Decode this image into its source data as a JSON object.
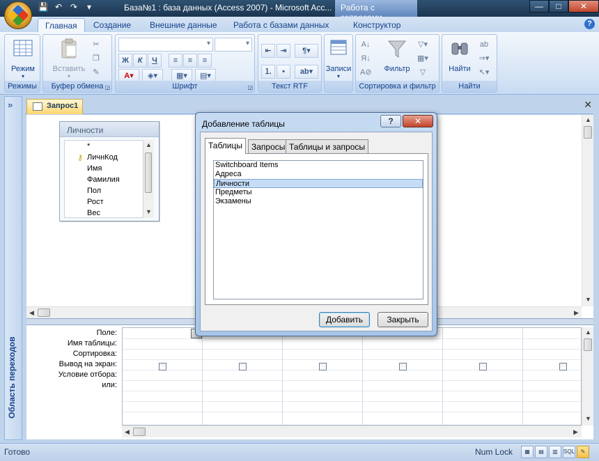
{
  "window": {
    "title": "База№1 : база данных (Access 2007) - Microsoft Acc...",
    "context_tab": "Работа с запросами",
    "controls": {
      "minimize": "—",
      "maximize": "□",
      "close": "✕"
    }
  },
  "quick_access": {
    "save": "💾",
    "undo": "↶",
    "redo": "↷",
    "customize": "▾"
  },
  "ribbon": {
    "tabs": [
      "Главная",
      "Создание",
      "Внешние данные",
      "Работа с базами данных",
      "Конструктор"
    ],
    "active_tab": "Главная",
    "help": "?",
    "groups": {
      "views": {
        "label": "Режимы",
        "button": "Режим"
      },
      "clipboard": {
        "label": "Буфер обмена",
        "button": "Вставить"
      },
      "font": {
        "label": "Шрифт",
        "bold": "Ж",
        "italic": "К",
        "underline": "Ч"
      },
      "rtf": {
        "label": "Текст RTF"
      },
      "records": {
        "label": "",
        "button": "Записи"
      },
      "sort_filter": {
        "label": "Сортировка и фильтр",
        "button": "Фильтр"
      },
      "find": {
        "label": "Найти",
        "button": "Найти"
      }
    }
  },
  "nav_pane": {
    "label": "Область переходов",
    "toggle": "»"
  },
  "document": {
    "tab_label": "Запрос1",
    "close": "✕"
  },
  "field_list": {
    "title": "Личности",
    "fields": [
      "*",
      "ЛичнКод",
      "Имя",
      "Фамилия",
      "Пол",
      "Рост",
      "Вес"
    ],
    "key_field_index": 1
  },
  "qbe_grid": {
    "row_labels": [
      "Поле:",
      "Имя таблицы:",
      "Сортировка:",
      "Вывод на экран:",
      "Условие отбора:",
      "или:"
    ],
    "column_count": 6
  },
  "dialog": {
    "title": "Добавление таблицы",
    "help": "?",
    "close": "✕",
    "tabs": [
      "Таблицы",
      "Запросы",
      "Таблицы и запросы"
    ],
    "active_tab": "Таблицы",
    "items": [
      "Switchboard Items",
      "Адреса",
      "Личности",
      "Предметы",
      "Экзамены"
    ],
    "selected_index": 2,
    "buttons": {
      "add": "Добавить",
      "close": "Закрыть"
    }
  },
  "statusbar": {
    "left": "Готово",
    "right": "Num Lock",
    "sql_label": "SQL"
  }
}
